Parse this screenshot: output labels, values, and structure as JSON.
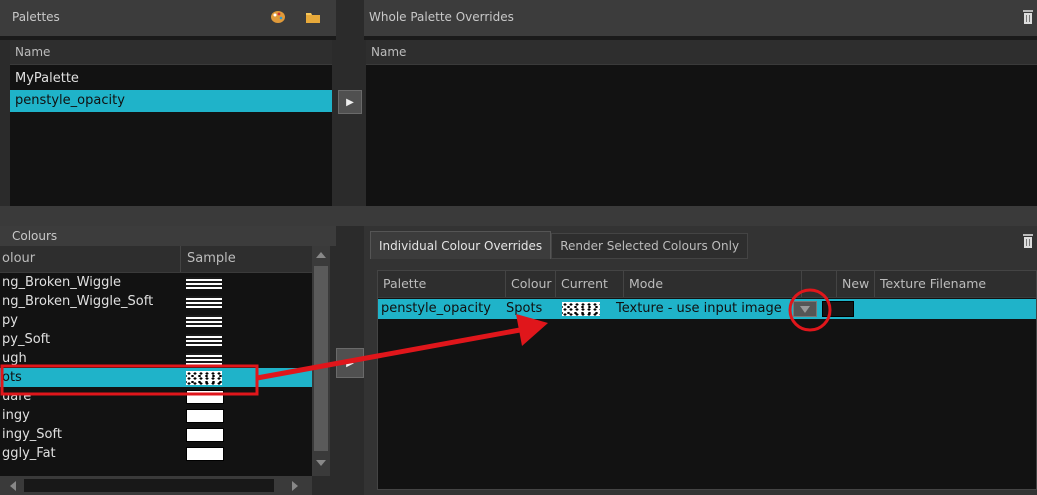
{
  "palettes_panel": {
    "title": "Palettes",
    "column": "Name",
    "items": [
      "MyPalette",
      "penstyle_opacity"
    ],
    "selected_index": 1
  },
  "whole_overrides_panel": {
    "title": "Whole Palette Overrides",
    "column": "Name"
  },
  "colours_panel": {
    "title": "Colours",
    "columns": [
      "olour",
      "Sample"
    ],
    "items": [
      {
        "label": "ng_Broken_Wiggle",
        "sample": "lines"
      },
      {
        "label": "ng_Broken_Wiggle_Soft",
        "sample": "lines"
      },
      {
        "label": "py",
        "sample": "lines"
      },
      {
        "label": "py_Soft",
        "sample": "lines"
      },
      {
        "label": "ugh",
        "sample": "lines"
      },
      {
        "label": "ots",
        "sample": "dots"
      },
      {
        "label": "uare",
        "sample": "block"
      },
      {
        "label": "ingy",
        "sample": "block"
      },
      {
        "label": "ingy_Soft",
        "sample": "block"
      },
      {
        "label": "ggly_Fat",
        "sample": "block"
      }
    ],
    "selected_index": 5
  },
  "tabs": [
    "Individual Colour Overrides",
    "Render Selected Colours Only"
  ],
  "active_tab": 0,
  "overrides_table": {
    "columns": [
      "Palette",
      "Colour",
      "Current",
      "Mode",
      "",
      "New",
      "Texture Filename"
    ],
    "rows": [
      {
        "palette": "penstyle_opacity",
        "colour": "Spots",
        "current": "dots",
        "mode": "Texture - use input image",
        "new": "",
        "texture": ""
      }
    ]
  },
  "icons": {
    "palette_add": "palette-icon",
    "folder": "folder-icon",
    "trash": "trash-icon",
    "arrow_right": "arrow-right-icon",
    "dropdown": "dropdown-arrow-icon"
  },
  "colors": {
    "selection": "#1fb3c9",
    "annotation": "#e0161b"
  }
}
